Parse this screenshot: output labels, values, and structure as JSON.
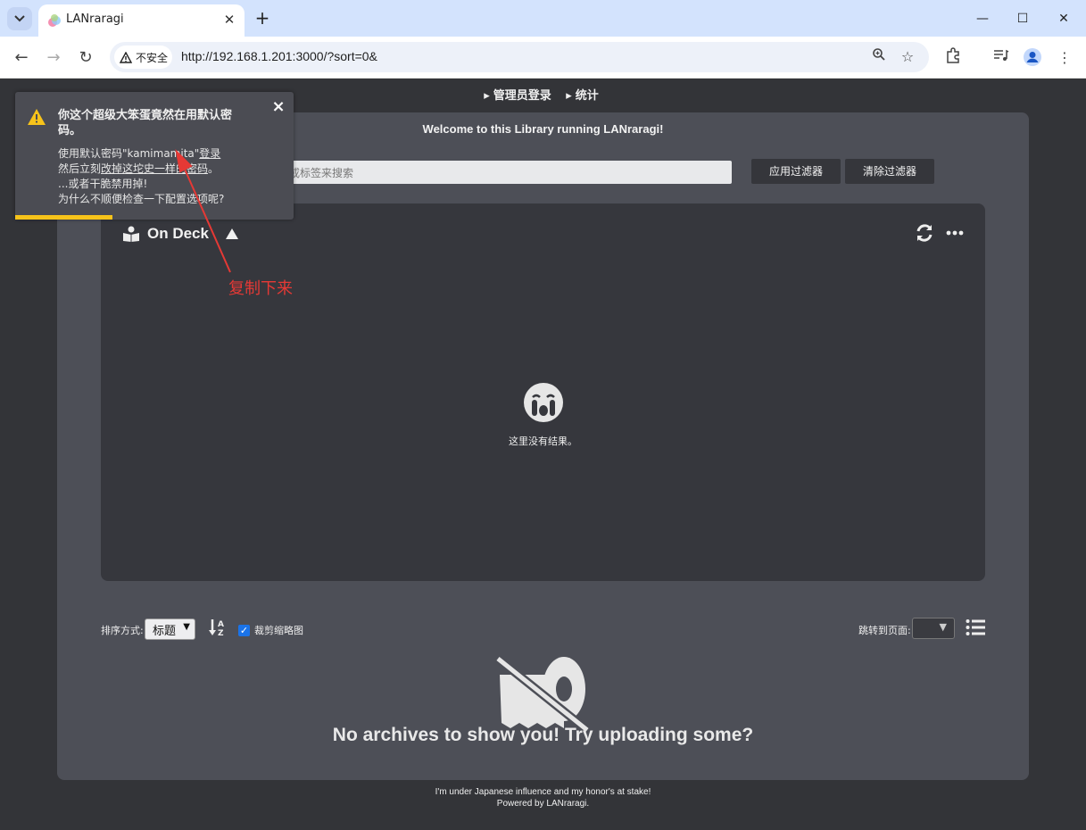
{
  "browser": {
    "tab_title": "LANraragi",
    "security_label": "不安全",
    "url": "http://192.168.1.201:3000/?sort=0&"
  },
  "nav": {
    "admin_login": "管理员登录",
    "stats": "统计"
  },
  "main": {
    "welcome": "Welcome to this Library running LANraragi!",
    "search_placeholder": "按标题或标签来搜索",
    "search_visible": "或标签来搜索",
    "apply_filter": "应用过滤器",
    "clear_filter": "清除过滤器"
  },
  "ondeck": {
    "title": "On Deck",
    "empty_text": "这里没有结果。"
  },
  "sort": {
    "label": "排序方式:",
    "selected": "标题",
    "crop_label": "裁剪缩略图",
    "crop_checked": true,
    "jump_label": "跳转到页面:"
  },
  "empty": {
    "message": "No archives to show you! Try uploading some?"
  },
  "footer": {
    "line1": "I'm under Japanese influence and my honor's at stake!",
    "line2": "Powered by LANraragi."
  },
  "toast": {
    "title": "你这个超级大笨蛋竟然在用默认密码。",
    "line1_prefix": "使用默认密码\"kamimamita\"",
    "line1_link": "登录",
    "line2_prefix": "然后立刻",
    "line2_link": "改掉这坨史一样的密码",
    "line2_suffix": "。",
    "line3": "...或者干脆禁用掉!",
    "line4": "为什么不顺便检查一下配置选项呢?",
    "close": "×"
  },
  "annotation": {
    "text": "复制下来",
    "color": "#e53935"
  },
  "colors": {
    "warning": "#f7c31a",
    "panel": "#4d4f57",
    "deck": "#36373d"
  }
}
